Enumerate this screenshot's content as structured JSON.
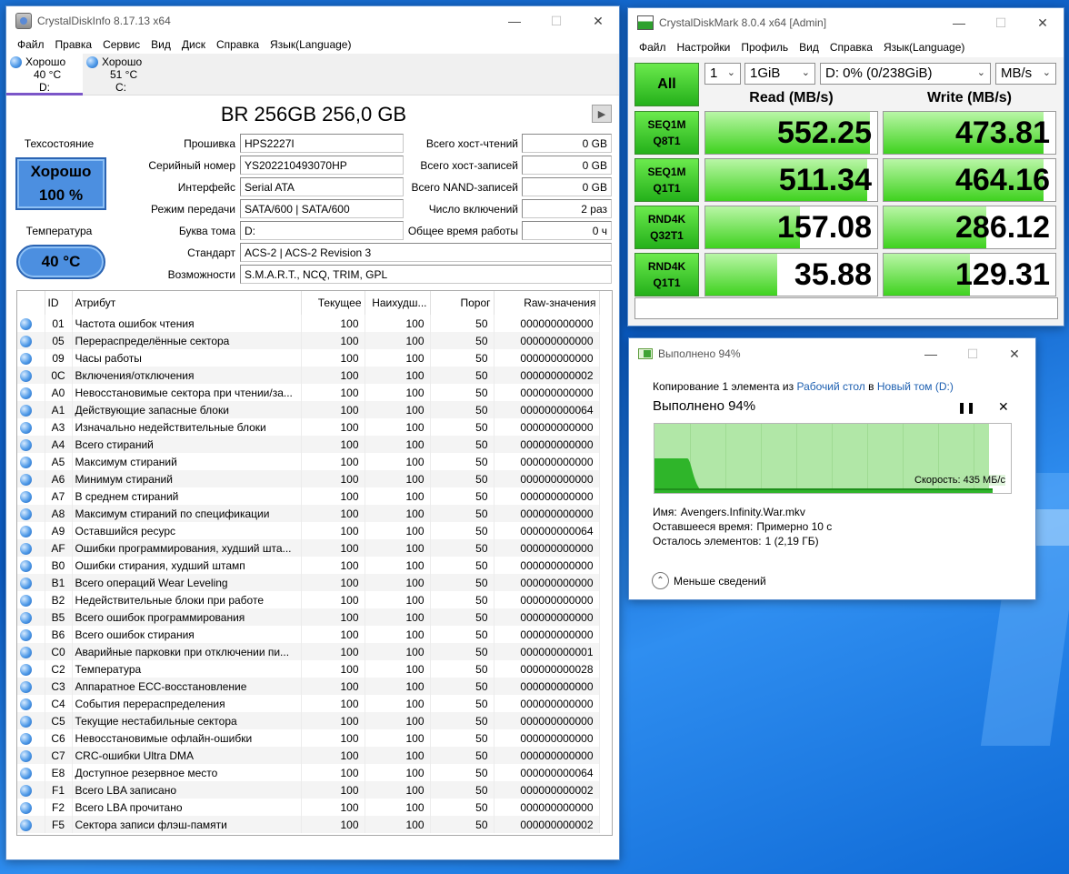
{
  "cdi": {
    "title": "CrystalDiskInfo 8.17.13 x64",
    "menu": [
      "Файл",
      "Правка",
      "Сервис",
      "Вид",
      "Диск",
      "Справка",
      "Язык(Language)"
    ],
    "drives": [
      {
        "status": "Хорошо",
        "temp": "40 °C",
        "letter": "D:"
      },
      {
        "status": "Хорошо",
        "temp": "51 °C",
        "letter": "C:"
      }
    ],
    "model": "BR 256GB 256,0 GB",
    "health_label": "Техсостояние",
    "health_status": "Хорошо",
    "health_percent": "100 %",
    "temp_label": "Температура",
    "temp_value": "40 °C",
    "info": {
      "firmware_label": "Прошивка",
      "firmware": "HPS2227I",
      "serial_label": "Серийный номер",
      "serial": "YS202210493070HP",
      "interface_label": "Интерфейс",
      "interface": "Serial ATA",
      "transfer_label": "Режим передачи",
      "transfer": "SATA/600 | SATA/600",
      "volume_label": "Буква тома",
      "volume": "D:",
      "standard_label": "Стандарт",
      "standard": "ACS-2 | ACS-2 Revision 3",
      "features_label": "Возможности",
      "features": "S.M.A.R.T., NCQ, TRIM, GPL",
      "host_reads_label": "Всего хост-чтений",
      "host_reads": "0 GB",
      "host_writes_label": "Всего хост-записей",
      "host_writes": "0 GB",
      "nand_writes_label": "Всего NAND-записей",
      "nand_writes": "0 GB",
      "power_count_label": "Число включений",
      "power_count": "2 раз",
      "power_hours_label": "Общее время работы",
      "power_hours": "0 ч"
    },
    "smart_headers": [
      "ID",
      "Атрибут",
      "Текущее",
      "Наихудш...",
      "Порог",
      "Raw-значения"
    ],
    "smart_rows": [
      [
        "01",
        "Частота ошибок чтения",
        "100",
        "100",
        "50",
        "000000000000"
      ],
      [
        "05",
        "Перераспределённые сектора",
        "100",
        "100",
        "50",
        "000000000000"
      ],
      [
        "09",
        "Часы работы",
        "100",
        "100",
        "50",
        "000000000000"
      ],
      [
        "0C",
        "Включения/отключения",
        "100",
        "100",
        "50",
        "000000000002"
      ],
      [
        "A0",
        "Невосстановимые сектора при чтении/за...",
        "100",
        "100",
        "50",
        "000000000000"
      ],
      [
        "A1",
        "Действующие запасные блоки",
        "100",
        "100",
        "50",
        "000000000064"
      ],
      [
        "A3",
        "Изначально недействительные блоки",
        "100",
        "100",
        "50",
        "000000000000"
      ],
      [
        "A4",
        "Всего стираний",
        "100",
        "100",
        "50",
        "000000000000"
      ],
      [
        "A5",
        "Максимум стираний",
        "100",
        "100",
        "50",
        "000000000000"
      ],
      [
        "A6",
        "Минимум стираний",
        "100",
        "100",
        "50",
        "000000000000"
      ],
      [
        "A7",
        "В среднем стираний",
        "100",
        "100",
        "50",
        "000000000000"
      ],
      [
        "A8",
        "Максимум стираний по спецификации",
        "100",
        "100",
        "50",
        "000000000000"
      ],
      [
        "A9",
        "Оставшийся ресурс",
        "100",
        "100",
        "50",
        "000000000064"
      ],
      [
        "AF",
        "Ошибки программирования, худший шта...",
        "100",
        "100",
        "50",
        "000000000000"
      ],
      [
        "B0",
        "Ошибки стирания, худший штамп",
        "100",
        "100",
        "50",
        "000000000000"
      ],
      [
        "B1",
        "Всего операций Wear Leveling",
        "100",
        "100",
        "50",
        "000000000000"
      ],
      [
        "B2",
        "Недействительные блоки при работе",
        "100",
        "100",
        "50",
        "000000000000"
      ],
      [
        "B5",
        "Всего ошибок программирования",
        "100",
        "100",
        "50",
        "000000000000"
      ],
      [
        "B6",
        "Всего ошибок стирания",
        "100",
        "100",
        "50",
        "000000000000"
      ],
      [
        "C0",
        "Аварийные парковки при отключении пи...",
        "100",
        "100",
        "50",
        "000000000001"
      ],
      [
        "C2",
        "Температура",
        "100",
        "100",
        "50",
        "000000000028"
      ],
      [
        "C3",
        "Аппаратное ECC-восстановление",
        "100",
        "100",
        "50",
        "000000000000"
      ],
      [
        "C4",
        "События перераспределения",
        "100",
        "100",
        "50",
        "000000000000"
      ],
      [
        "C5",
        "Текущие нестабильные сектора",
        "100",
        "100",
        "50",
        "000000000000"
      ],
      [
        "C6",
        "Невосстановимые офлайн-ошибки",
        "100",
        "100",
        "50",
        "000000000000"
      ],
      [
        "C7",
        "CRC-ошибки Ultra DMA",
        "100",
        "100",
        "50",
        "000000000000"
      ],
      [
        "E8",
        "Доступное резервное место",
        "100",
        "100",
        "50",
        "000000000064"
      ],
      [
        "F1",
        "Всего LBA записано",
        "100",
        "100",
        "50",
        "000000000002"
      ],
      [
        "F2",
        "Всего LBA прочитано",
        "100",
        "100",
        "50",
        "000000000000"
      ],
      [
        "F5",
        "Сектора записи флэш-памяти",
        "100",
        "100",
        "50",
        "000000000002"
      ]
    ]
  },
  "cdm": {
    "title": "CrystalDiskMark 8.0.4 x64 [Admin]",
    "menu": [
      "Файл",
      "Настройки",
      "Профиль",
      "Вид",
      "Справка",
      "Язык(Language)"
    ],
    "all_label": "All",
    "count": "1",
    "size": "1GiB",
    "drive": "D: 0% (0/238GiB)",
    "unit": "MB/s",
    "read_header": "Read (MB/s)",
    "write_header": "Write (MB/s)",
    "tests": [
      {
        "l1": "SEQ1M",
        "l2": "Q8T1",
        "read": "552.25",
        "write": "473.81",
        "read_frac": 0.96,
        "write_frac": 0.93
      },
      {
        "l1": "SEQ1M",
        "l2": "Q1T1",
        "read": "511.34",
        "write": "464.16",
        "read_frac": 0.94,
        "write_frac": 0.93
      },
      {
        "l1": "RND4K",
        "l2": "Q32T1",
        "read": "157.08",
        "write": "286.12",
        "read_frac": 0.55,
        "write_frac": 0.6
      },
      {
        "l1": "RND4K",
        "l2": "Q1T1",
        "read": "35.88",
        "write": "129.31",
        "read_frac": 0.42,
        "write_frac": 0.5
      }
    ]
  },
  "copy": {
    "title": "Выполнено 94%",
    "line_prefix": "Копирование 1 элемента из",
    "source": "Рабочий стол",
    "line_mid": "в",
    "dest": "Новый том (D:)",
    "percent_text": "Выполнено 94%",
    "progress": 0.94,
    "speed": "Скорость: 435 МБ/с",
    "name_label": "Имя:",
    "name": "Avengers.Infinity.War.mkv",
    "remaining_label": "Оставшееся время:",
    "remaining": "Примерно 10 с",
    "items_label": "Осталось элементов:",
    "items": "1 (2,19 ГБ)",
    "less_label": "Меньше сведений"
  }
}
